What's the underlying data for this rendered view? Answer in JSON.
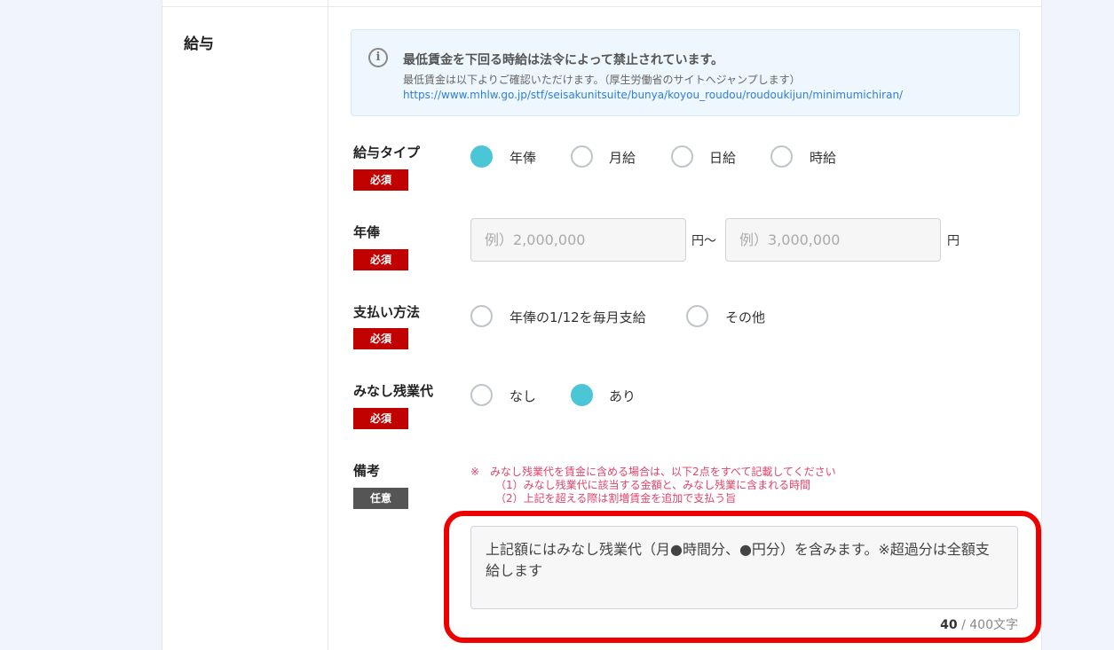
{
  "section": {
    "label": "給与"
  },
  "notice": {
    "title": "最低賃金を下回る時給は法令によって禁止されています。",
    "subtitle": "最低賃金は以下よりご確認いただけます。（厚生労働省のサイトへジャンプします）",
    "link": "https://www.mhlw.go.jp/stf/seisakunitsuite/bunya/koyou_roudou/roudoukijun/minimumichiran/",
    "icon": "info-icon"
  },
  "badges": {
    "required": "必須",
    "optional": "任意"
  },
  "salary_type": {
    "label": "給与タイプ",
    "options": [
      "年俸",
      "月給",
      "日給",
      "時給"
    ],
    "selected": "年俸"
  },
  "annual_salary": {
    "label": "年俸",
    "min_placeholder": "例）2,000,000",
    "min_value": "",
    "unit_between": "円〜",
    "max_placeholder": "例）3,000,000",
    "max_value": "",
    "unit_end": "円"
  },
  "payment_method": {
    "label": "支払い方法",
    "options": [
      "年俸の1/12を毎月支給",
      "その他"
    ],
    "selected": ""
  },
  "overtime": {
    "label": "みなし残業代",
    "options": [
      "なし",
      "あり"
    ],
    "selected": "あり"
  },
  "remarks": {
    "label": "備考",
    "note_lines": [
      "※　みなし残業代を賃金に含める場合は、以下2点をすべて記載してください",
      "（1）みなし残業代に該当する金額と、みなし残業に含まれる時間",
      "（2）上記を超える際は割増賃金を追加で支払う旨"
    ],
    "value": "上記額にはみなし残業代（月●時間分、●円分）を含みます。※超過分は全額支給します",
    "count": "40",
    "separator": "/",
    "limit": "400文字"
  },
  "colors": {
    "accent": "#4ac6d6",
    "required_badge": "#c10000",
    "optional_badge": "#555555",
    "note": "#e0446a",
    "highlight": "#ef0000",
    "link": "#2f7ed8"
  }
}
